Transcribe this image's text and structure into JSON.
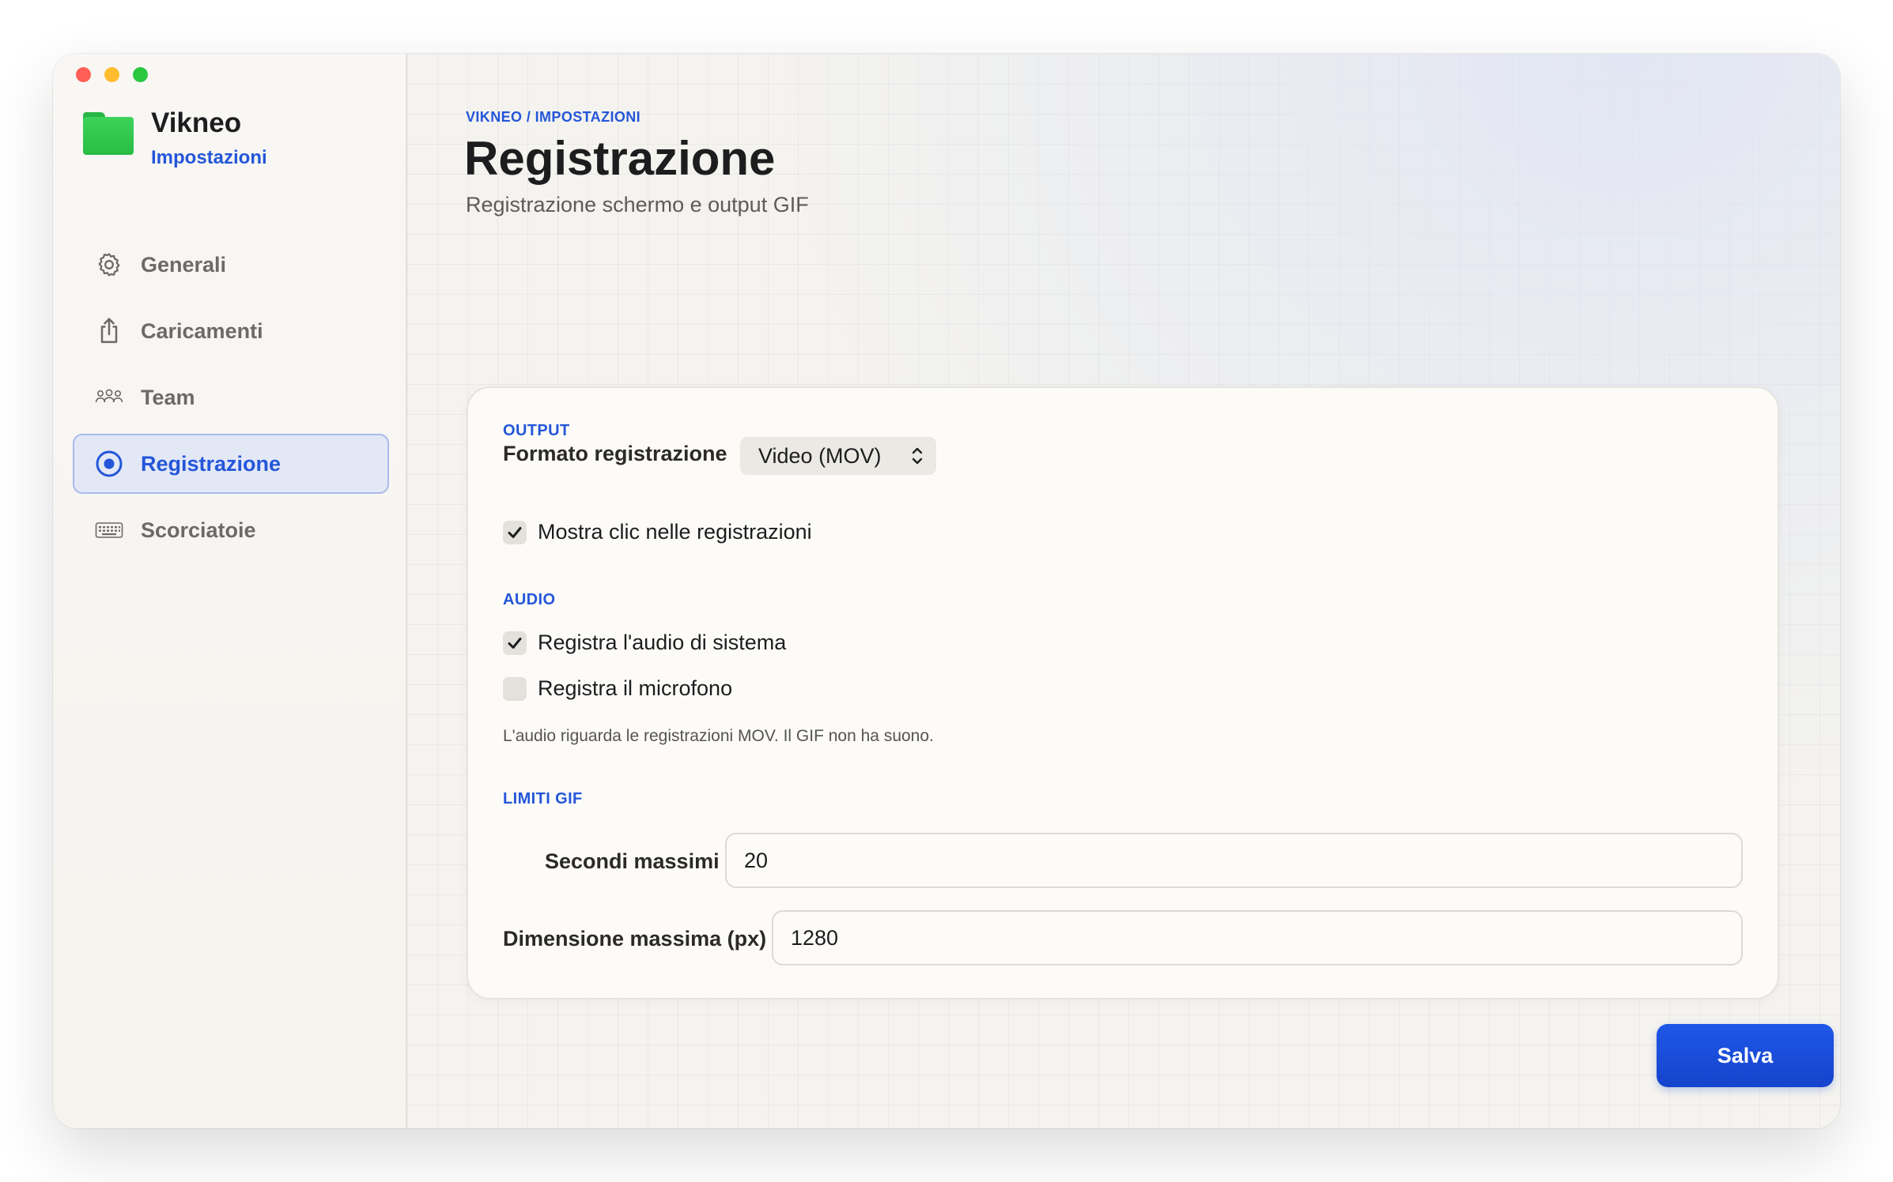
{
  "window": {
    "controls": [
      "close",
      "minimize",
      "zoom"
    ]
  },
  "app": {
    "name": "Vikneo",
    "section": "Impostazioni",
    "icon": "folder-icon",
    "accent_color": "#2456d9"
  },
  "sidebar": {
    "items": [
      {
        "label": "Generali",
        "icon": "gear-icon",
        "active": false
      },
      {
        "label": "Caricamenti",
        "icon": "upload-icon",
        "active": false
      },
      {
        "label": "Team",
        "icon": "people-icon",
        "active": false
      },
      {
        "label": "Registrazione",
        "icon": "record-icon",
        "active": true
      },
      {
        "label": "Scorciatoie",
        "icon": "keyboard-icon",
        "active": false
      }
    ]
  },
  "header": {
    "breadcrumb": "VIKNEO / IMPOSTAZIONI",
    "title": "Registrazione",
    "subtitle": "Registrazione schermo e output GIF"
  },
  "output": {
    "section_label": "OUTPUT",
    "format_label": "Formato registrazione",
    "format_value": "Video (MOV)",
    "show_clicks_label": "Mostra clic nelle registrazioni",
    "show_clicks_checked": true
  },
  "audio": {
    "section_label": "AUDIO",
    "system_audio_label": "Registra l'audio di sistema",
    "system_audio_checked": true,
    "microphone_label": "Registra il microfono",
    "microphone_checked": false,
    "hint": "L'audio riguarda le registrazioni MOV. Il GIF non ha suono."
  },
  "gif_limits": {
    "section_label": "LIMITI GIF",
    "max_seconds_label": "Secondi massimi",
    "max_seconds_value": "20",
    "max_size_label": "Dimensione massima (px)",
    "max_size_value": "1280"
  },
  "actions": {
    "save_label": "Salva",
    "save_color": "#1a4fe0"
  }
}
